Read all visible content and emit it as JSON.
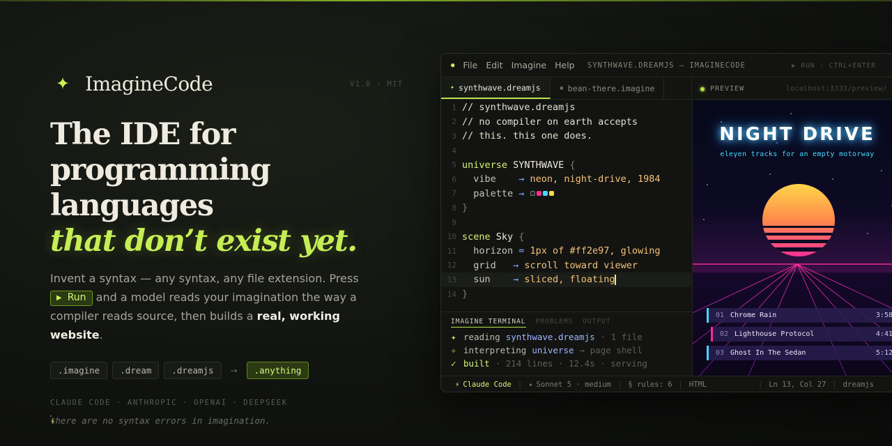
{
  "brand": {
    "name": "ImagineCode",
    "mark": "✦",
    "version": "V1.0 · MIT"
  },
  "hero": {
    "headline_1": "The IDE for",
    "headline_2": "programming languages",
    "headline_accent": "that don’t exist yet.",
    "lede_1": "Invent a syntax — any syntax, any file extension. Press",
    "run_label": "Run",
    "lede_2": " and a model reads your imagination the way a compiler reads source, then builds a ",
    "lede_strong": "real, working website",
    "lede_3": ".",
    "extensions": [
      ".imagine",
      ".dream",
      ".dreamjs"
    ],
    "arrow": "→",
    "extension_highlight": ".anything",
    "vendors": "CLAUDE CODE · ANTHROPIC · OPENAI · DEEPSEEK",
    "motto": "there are no syntax errors in imagination."
  },
  "ide": {
    "menu": [
      "File",
      "Edit",
      "Imagine",
      "Help"
    ],
    "window_title": "SYNTHWAVE.DREAMJS — IMAGINECODE",
    "run_hint": "▶ RUN · CTRL+ENTER",
    "tabs": [
      {
        "label": "synthwave.dreamjs"
      },
      {
        "label": "bean-there.imagine"
      }
    ],
    "preview_label": "PREVIEW",
    "preview_url": "localhost:3333/preview/",
    "code": [
      {
        "n": "1",
        "t": "// synthwave.dreamjs"
      },
      {
        "n": "2",
        "t": "// no compiler on earth accepts"
      },
      {
        "n": "3",
        "t": "// this. this one does."
      },
      {
        "n": "4",
        "t": ""
      },
      {
        "n": "5",
        "kw": "universe",
        "id": " SYNTHWAVE ",
        "br": "{"
      },
      {
        "n": "6",
        "prop": "  vibe    ",
        "arr": "→ ",
        "str": "neon, night-drive, 1984"
      },
      {
        "n": "7",
        "prop": "  palette ",
        "arr": "→ "
      },
      {
        "n": "8",
        "br": "}"
      },
      {
        "n": "9",
        "t": ""
      },
      {
        "n": "10",
        "kw": "scene",
        "id": " Sky ",
        "br": "{"
      },
      {
        "n": "11",
        "prop": "  horizon ",
        "arr": "= ",
        "str": "1px of #ff2e97, glowing"
      },
      {
        "n": "12",
        "prop": "  grid   ",
        "arr": "→ ",
        "str": "scroll toward viewer"
      },
      {
        "n": "13",
        "prop": "  sun    ",
        "arr": "→ ",
        "str": "sliced, floating"
      },
      {
        "n": "14",
        "br": "}"
      }
    ],
    "palette_colors": [
      "#222222",
      "#ff2e97",
      "#47d9ff",
      "#ffd84a"
    ],
    "terminal": {
      "tabs": [
        "IMAGINE TERMINAL",
        "PROBLEMS",
        "OUTPUT"
      ],
      "lines": [
        {
          "icon": "✦",
          "verb": "reading",
          "arg": "synthwave.dreamjs",
          "meta": "· 1 file"
        },
        {
          "icon": "✧",
          "verb": "interpreting",
          "arg": "universe",
          "meta": "→ page shell"
        },
        {
          "icon": "✓",
          "verb": "built",
          "arg": "",
          "meta": "· 214 lines · 12.4s · serving"
        }
      ]
    },
    "status": {
      "agent": "Claude Code",
      "model": "Sonnet 5 · medium",
      "rules": "§ rules: 6",
      "lang": "HTML",
      "position": "Ln 13, Col 27",
      "filetype": "dreamjs"
    }
  },
  "preview_site": {
    "title": "NIGHT DRIVE",
    "subtitle": "eleven tracks for an empty motorway",
    "tracks": [
      {
        "num": "01",
        "name": "Chrome Rain",
        "dur": "3:58",
        "accent": "#47d9ff"
      },
      {
        "num": "02",
        "name": "Lighthouse Protocol",
        "dur": "4:41",
        "accent": "#ff2e97"
      },
      {
        "num": "03",
        "name": "Ghost In The Sedan",
        "dur": "5:12",
        "accent": "#47d9ff"
      }
    ]
  },
  "colors": {
    "accent": "#c5ee55",
    "neon_pink": "#ff2e97",
    "neon_cyan": "#47d9ff"
  }
}
